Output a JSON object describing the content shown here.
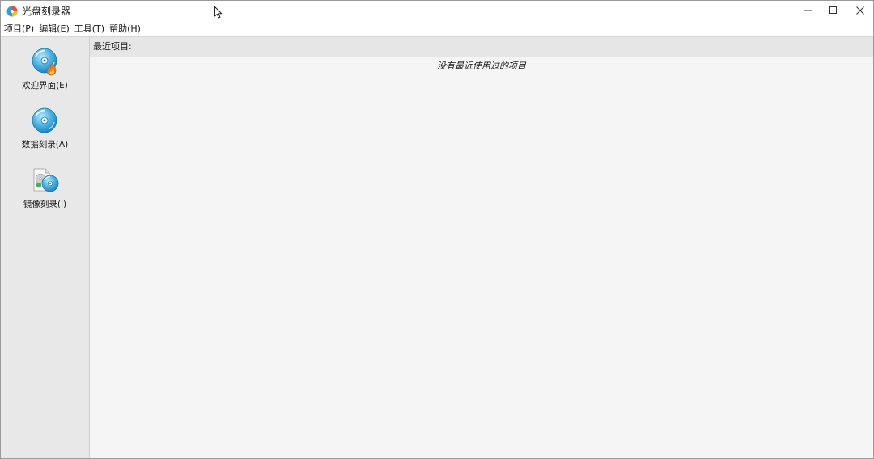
{
  "window": {
    "title": "光盘刻录器"
  },
  "menu": {
    "items": [
      {
        "label": "项目(P)"
      },
      {
        "label": "编辑(E)"
      },
      {
        "label": "工具(T)"
      },
      {
        "label": "帮助(H)"
      }
    ]
  },
  "sidebar": {
    "items": [
      {
        "label": "欢迎界面(E)",
        "icon": "disc-flame-icon"
      },
      {
        "label": "数据刻录(A)",
        "icon": "disc-icon"
      },
      {
        "label": "镜像刻录(I)",
        "icon": "disc-image-file-icon"
      }
    ]
  },
  "main": {
    "recent_header": "最近项目:",
    "empty_message": "没有最近使用过的项目"
  },
  "colors": {
    "disc_blue": "#2f9fd8",
    "disc_light": "#8fd3f2",
    "flame_orange": "#f07a1a",
    "sidebar_bg": "#e8e8e8",
    "content_bg": "#f5f5f5"
  }
}
